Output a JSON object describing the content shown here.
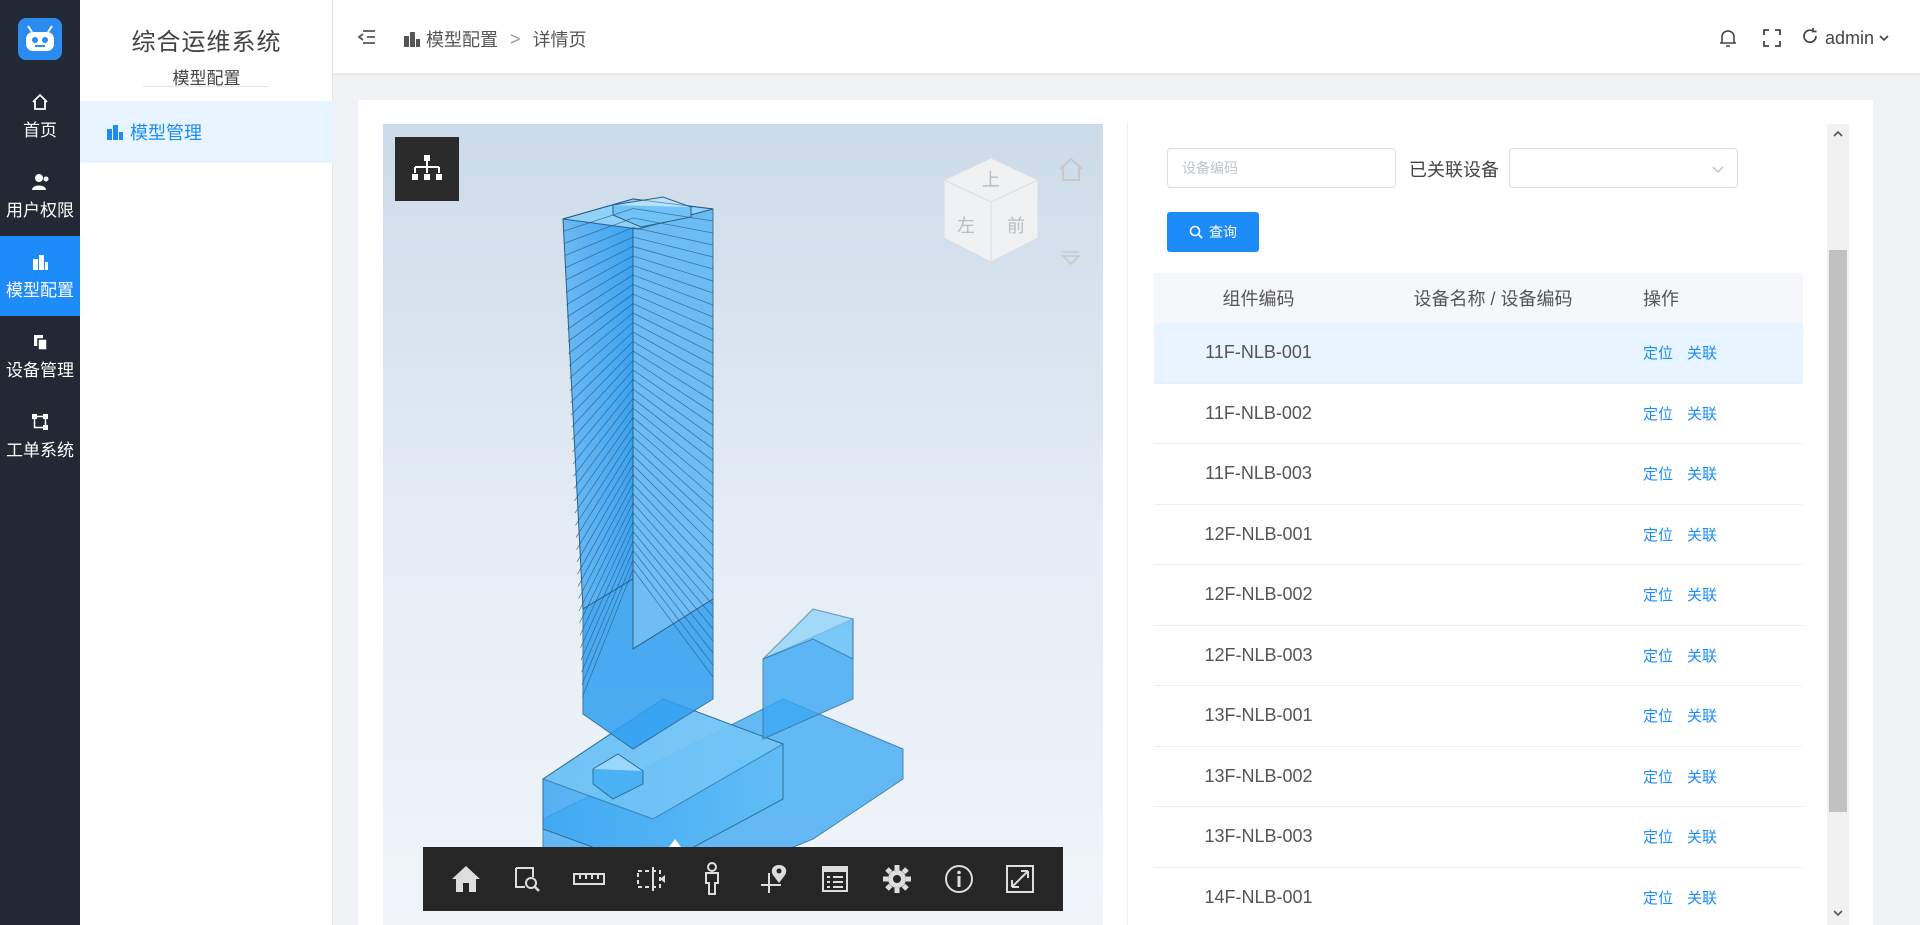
{
  "rail": {
    "items": [
      {
        "label": "首页",
        "icon": "home-icon"
      },
      {
        "label": "用户权限",
        "icon": "user-icon"
      },
      {
        "label": "模型配置",
        "icon": "building-icon",
        "active": true
      },
      {
        "label": "设备管理",
        "icon": "device-icon"
      },
      {
        "label": "工单系统",
        "icon": "workflow-icon"
      }
    ]
  },
  "submenu": {
    "title": "综合运维系统",
    "subtitle": "模型配置",
    "items": [
      {
        "label": "模型管理",
        "icon": "building-icon"
      }
    ]
  },
  "header": {
    "breadcrumb": [
      "模型配置",
      "详情页"
    ],
    "separator": ">",
    "user": "admin"
  },
  "viewer": {
    "viewcube": {
      "top": "上",
      "left": "左",
      "front": "前"
    },
    "toolbar": [
      "home-icon",
      "zoom-window-icon",
      "measure-icon",
      "section-box-icon",
      "first-person-icon",
      "explode-icon",
      "properties-icon",
      "settings-icon",
      "info-icon",
      "fullscreen-icon"
    ]
  },
  "filter": {
    "device_code_placeholder": "设备编码",
    "linked_label": "已关联设备",
    "linked_value": "",
    "query_label": "查询"
  },
  "table": {
    "headers": [
      "组件编码",
      "设备名称 / 设备编码",
      "操作"
    ],
    "actions": [
      "定位",
      "关联"
    ],
    "rows": [
      {
        "code": "11F-NLB-001",
        "device": ""
      },
      {
        "code": "11F-NLB-002",
        "device": ""
      },
      {
        "code": "11F-NLB-003",
        "device": ""
      },
      {
        "code": "12F-NLB-001",
        "device": ""
      },
      {
        "code": "12F-NLB-002",
        "device": ""
      },
      {
        "code": "12F-NLB-003",
        "device": ""
      },
      {
        "code": "13F-NLB-001",
        "device": ""
      },
      {
        "code": "13F-NLB-002",
        "device": ""
      },
      {
        "code": "13F-NLB-003",
        "device": ""
      },
      {
        "code": "14F-NLB-001",
        "device": ""
      }
    ]
  },
  "colors": {
    "accent": "#1d8cf8",
    "rail_bg": "#222834",
    "highlight_row": "#e8f4ff"
  }
}
